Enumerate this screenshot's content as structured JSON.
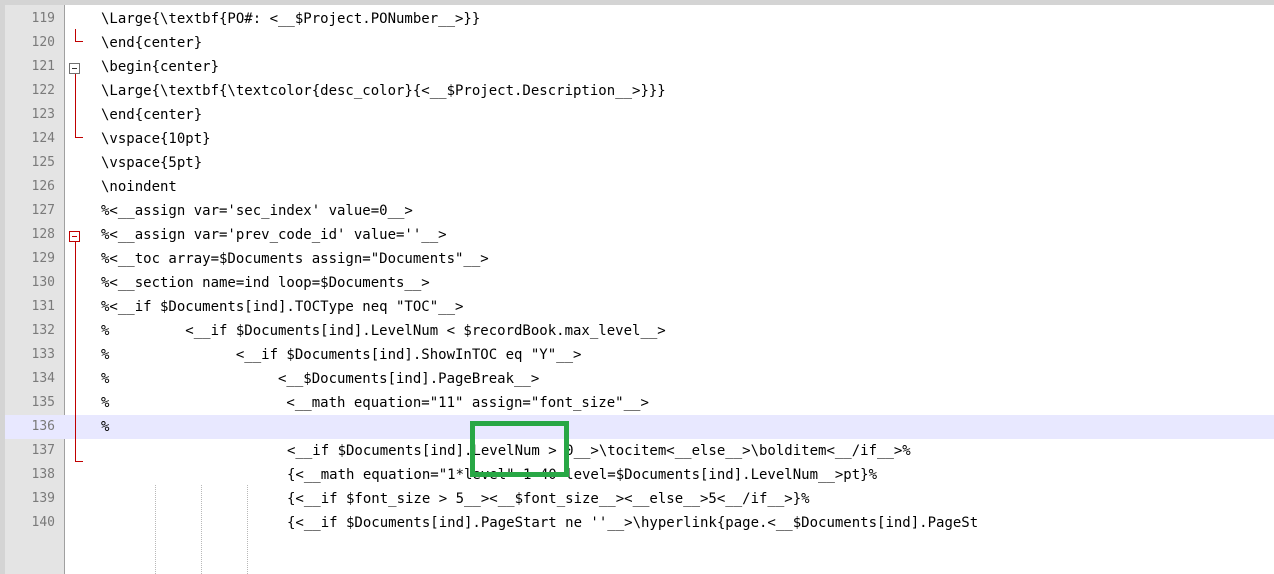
{
  "editor": {
    "lines": [
      {
        "num": "119",
        "text": "\\Large{\\textbf{PO#: <__$Project.PONumber__>}}"
      },
      {
        "num": "120",
        "text": "\\end{center}"
      },
      {
        "num": "121",
        "text": "\\begin{center}"
      },
      {
        "num": "122",
        "text": "\\Large{\\textbf{\\textcolor{desc_color}{<__$Project.Description__>}}}"
      },
      {
        "num": "123",
        "text": "\\end{center}"
      },
      {
        "num": "124",
        "text": "\\vspace{10pt}"
      },
      {
        "num": "125",
        "text": "\\vspace{5pt}"
      },
      {
        "num": "126",
        "text": "\\noindent"
      },
      {
        "num": "127",
        "text": "%<__assign var='sec_index' value=0__>"
      },
      {
        "num": "128",
        "text": "%<__assign var='prev_code_id' value=''__>"
      },
      {
        "num": "129",
        "text": "%<__toc array=$Documents assign=\"Documents\"__>"
      },
      {
        "num": "130",
        "text": "%<__section name=ind loop=$Documents__>"
      },
      {
        "num": "131",
        "text": "%<__if $Documents[ind].TOCType neq \"TOC\"__>"
      },
      {
        "num": "132",
        "text": "%         <__if $Documents[ind].LevelNum < $recordBook.max_level__>"
      },
      {
        "num": "133",
        "text": "%               <__if $Documents[ind].ShowInTOC eq \"Y\"__>"
      },
      {
        "num": "134",
        "text": "%                    <__$Documents[ind].PageBreak__>"
      },
      {
        "num": "135",
        "text": "%                     <__math equation=\"11\" assign=\"font_size\"__>"
      },
      {
        "num": "136",
        "text": "%"
      },
      {
        "num": "137",
        "text": "<__if $Documents[ind].LevelNum > 0__>\\tocitem<__else__>\\bolditem<__/if__>%"
      },
      {
        "num": "138",
        "text": "{<__math equation=\"1*level\" 1=40 level=$Documents[ind].LevelNum__>pt}%"
      },
      {
        "num": "139",
        "text": "{<__if $font_size > 5__><__$font_size__><__else__>5<__/if__>}%"
      },
      {
        "num": "140",
        "text": "{<__if $Documents[ind].PageStart ne ''__>\\hyperlink{page.<__$Documents[ind].PageSt"
      }
    ],
    "current_line": "136"
  },
  "highlight": {
    "color": "#28a745",
    "label": "green highlight box"
  }
}
